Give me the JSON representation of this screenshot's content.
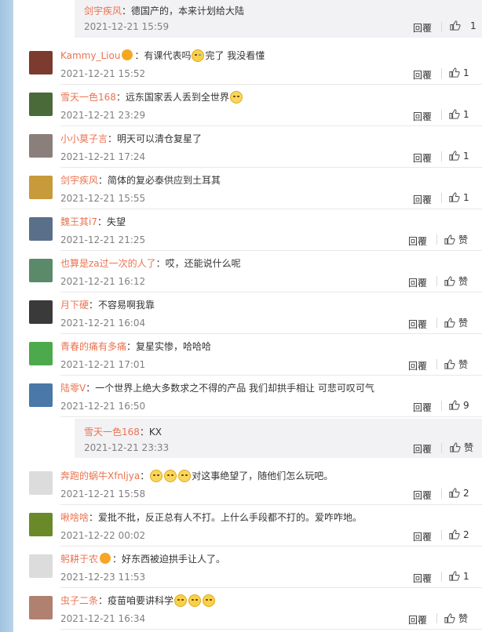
{
  "nested_top": {
    "user": "剑宇疾风",
    "text": "：德国产的，本来计划给大陆",
    "time": "2021-12-21 15:59",
    "reply": "回覆",
    "likes": "1"
  },
  "comments": [
    {
      "user": "Kammy_Liou",
      "text_pre": "：有课代表吗",
      "text_post": "完了 我没看懂",
      "time": "2021-12-21 15:52",
      "reply": "回覆",
      "likes": "1",
      "avatar": "#7b3b2e"
    },
    {
      "user": "雪天一色168",
      "text_pre": "：远东国家丢人丢到全世界",
      "text_post": "",
      "time": "2021-12-21 23:29",
      "reply": "回覆",
      "likes": "1",
      "avatar": "#4a6a3a"
    },
    {
      "user": "小小莫子言",
      "text_pre": "：明天可以清仓复星了",
      "text_post": "",
      "time": "2021-12-21 17:24",
      "reply": "回覆",
      "likes": "1",
      "avatar": "#8a7f7a"
    },
    {
      "user": "剑宇疾风",
      "text_pre": "：简体的复必泰供应到土耳其",
      "text_post": "",
      "time": "2021-12-21 15:55",
      "reply": "回覆",
      "likes": "1",
      "avatar": "#c79a3a"
    },
    {
      "user": "魏王其i7",
      "text_pre": "：失望",
      "text_post": "",
      "time": "2021-12-21 21:25",
      "reply": "回覆",
      "likes": "赞",
      "avatar": "#5a6f8a"
    },
    {
      "user": "也算是za过一次的人了",
      "text_pre": "：哎，还能说什么呢",
      "text_post": "",
      "time": "2021-12-21 16:12",
      "reply": "回覆",
      "likes": "赞",
      "avatar": "#5a8a6a"
    },
    {
      "user": "月下硬",
      "text_pre": "：不容易啊我靠",
      "text_post": "",
      "time": "2021-12-21 16:04",
      "reply": "回覆",
      "likes": "赞",
      "avatar": "#3a3a3a"
    },
    {
      "user": "青春的痛有多痛",
      "text_pre": "：复星实惨，哈哈哈",
      "text_post": "",
      "time": "2021-12-21 17:01",
      "reply": "回覆",
      "likes": "赞",
      "avatar": "#4caa4c"
    },
    {
      "user": "陆零V",
      "text_pre": "：一个世界上绝大多数求之不得的产品 我们却拱手相让 可悲可叹可气",
      "text_post": "",
      "time": "2021-12-21 16:50",
      "reply": "回覆",
      "likes": "9",
      "avatar": "#4a78a8"
    }
  ],
  "nested_box": {
    "user": "雪天一色168",
    "text": "：KX",
    "time": "2021-12-21 23:33",
    "reply": "回覆",
    "likes": "赞"
  },
  "comments2": [
    {
      "user": "奔跑的蜗牛Xfnljya",
      "text_pre": "：",
      "text_post": "对这事绝望了，随他们怎么玩吧。",
      "time": "2021-12-21 15:58",
      "reply": "回覆",
      "likes": "2",
      "avatar": "#dcdcdc"
    },
    {
      "user": "啾啥啥",
      "text_pre": "：爱批不批，反正总有人不打。上什么手段都不打的。爱咋咋地。",
      "text_post": "",
      "time": "2021-12-22 00:02",
      "reply": "回覆",
      "likes": "2",
      "avatar": "#6a8a2a"
    },
    {
      "user": "躬耕于农",
      "text_pre": "：好东西被迫拱手让人了。",
      "text_post": "",
      "time": "2021-12-23 11:53",
      "reply": "回覆",
      "likes": "1",
      "avatar": "#dcdcdc"
    },
    {
      "user": "虫子二条",
      "text_pre": "：疫苗咱要讲科学",
      "text_post": "",
      "time": "2021-12-21 16:34",
      "reply": "回覆",
      "likes": "赞",
      "avatar": "#b08070"
    }
  ]
}
